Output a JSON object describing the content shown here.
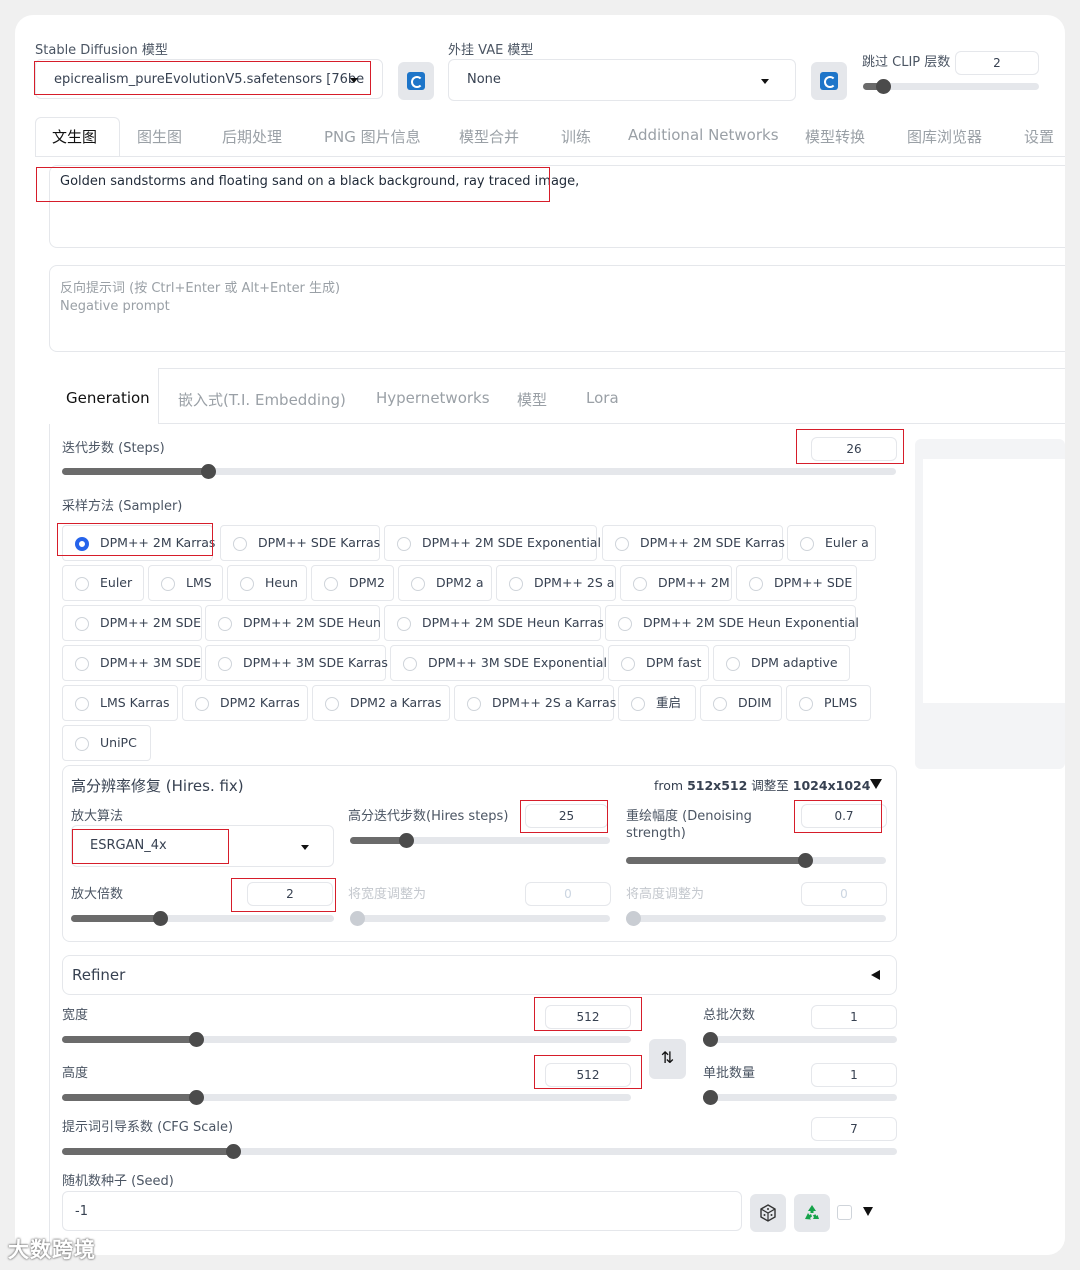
{
  "top": {
    "sd_model_label": "Stable Diffusion 模型",
    "sd_model_value": "epicrealism_pureEvolutionV5.safetensors [76be",
    "vae_label": "外挂 VAE 模型",
    "vae_value": "None",
    "clip_label": "跳过 CLIP 层数",
    "clip_value": "2",
    "clip_level": 0.08
  },
  "tabs": [
    "文生图",
    "图生图",
    "后期处理",
    "PNG 图片信息",
    "模型合并",
    "训练",
    "Additional Networks",
    "模型转换",
    "图库浏览器",
    "设置"
  ],
  "active_tab": 0,
  "prompt": {
    "value": "Golden sandstorms and floating sand on a black background, ray traced image,"
  },
  "negative_prompt": {
    "label": "反向提示词 (按 Ctrl+Enter 或 Alt+Enter 生成)",
    "placeholder": "Negative prompt"
  },
  "subtabs": [
    "Generation",
    "嵌入式(T.I. Embedding)",
    "Hypernetworks",
    "模型",
    "Lora"
  ],
  "steps": {
    "label": "迭代步数 (Steps)",
    "value": "26",
    "level": 0.17
  },
  "sampler": {
    "label": "采样方法 (Sampler)",
    "selected": "DPM++ 2M Karras",
    "rows": [
      [
        "DPM++ 2M Karras",
        "DPM++ SDE Karras",
        "DPM++ 2M SDE Exponential",
        "DPM++ 2M SDE Karras",
        "Euler a"
      ],
      [
        "Euler",
        "LMS",
        "Heun",
        "DPM2",
        "DPM2 a",
        "DPM++ 2S a",
        "DPM++ 2M",
        "DPM++ SDE"
      ],
      [
        "DPM++ 2M SDE",
        "DPM++ 2M SDE Heun",
        "DPM++ 2M SDE Heun Karras",
        "DPM++ 2M SDE Heun Exponential"
      ],
      [
        "DPM++ 3M SDE",
        "DPM++ 3M SDE Karras",
        "DPM++ 3M SDE Exponential",
        "DPM fast",
        "DPM adaptive"
      ],
      [
        "LMS Karras",
        "DPM2 Karras",
        "DPM2 a Karras",
        "DPM++ 2S a Karras",
        "重启",
        "DDIM",
        "PLMS"
      ],
      [
        "UniPC"
      ]
    ]
  },
  "hires": {
    "title": "高分辨率修复 (Hires. fix)",
    "info_prefix": "from ",
    "info_from": "512x512",
    "info_mid": " 调整至 ",
    "info_to": "1024x1024",
    "upscaler_label": "放大算法",
    "upscaler_value": "ESRGAN_4x",
    "steps_label": "高分迭代步数(Hires steps)",
    "steps_value": "25",
    "steps_level": 0.2,
    "denoise_label_1": "重绘幅度 (Denoising",
    "denoise_label_2": "strength)",
    "denoise_value": "0.7",
    "denoise_level": 0.7,
    "scale_label": "放大倍数",
    "scale_value": "2",
    "scale_level": 0.33,
    "resize_w_label": "将宽度调整为",
    "resize_w_value": "0",
    "resize_h_label": "将高度调整为",
    "resize_h_value": "0"
  },
  "refiner": {
    "title": "Refiner"
  },
  "width": {
    "label": "宽度",
    "value": "512",
    "level": 0.23
  },
  "height": {
    "label": "高度",
    "value": "512",
    "level": 0.23
  },
  "batch_count": {
    "label": "总批次数",
    "value": "1",
    "level": 0.0
  },
  "batch_size": {
    "label": "单批数量",
    "value": "1",
    "level": 0.0
  },
  "cfg": {
    "label": "提示词引导系数 (CFG Scale)",
    "value": "7",
    "level": 0.2
  },
  "seed": {
    "label": "随机数种子 (Seed)",
    "value": "-1"
  },
  "watermark": "大数跨境",
  "colors": {
    "accent": "#2563eb",
    "highlight": "#d61d2a",
    "refresh": "#1d75c9",
    "recycle": "#16a34a"
  }
}
